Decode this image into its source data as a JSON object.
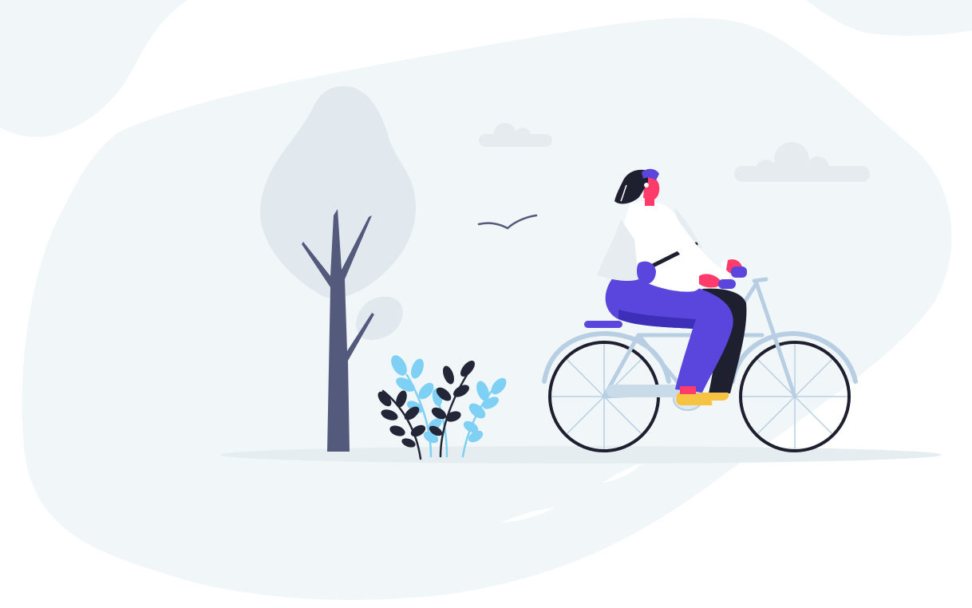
{
  "illustration": {
    "subject": "",
    "colors": {
      "background": "#ffffff",
      "blob": "#f1f6f9",
      "blob_light": "#e9f0f5",
      "tree_foliage": "#e2e9ee",
      "trunk": "#535a7c",
      "cloud": "#e6ebef",
      "ground_shadow": "#e8eef2",
      "bird": "#535a7c",
      "plant_blue": "#7fd0f5",
      "plant_dark": "#232637",
      "tire": "#1e2030",
      "frame": "#b8cfe3",
      "pants": "#5a45dd",
      "pants_shadow": "#3d2fb8",
      "shirt": "#ffffff",
      "shirt_shadow": "#e6ecf0",
      "skin": "#ff3b6b",
      "hair": "#1e2030",
      "helmet": "#5a45dd",
      "shoe": "#f6c342"
    }
  }
}
